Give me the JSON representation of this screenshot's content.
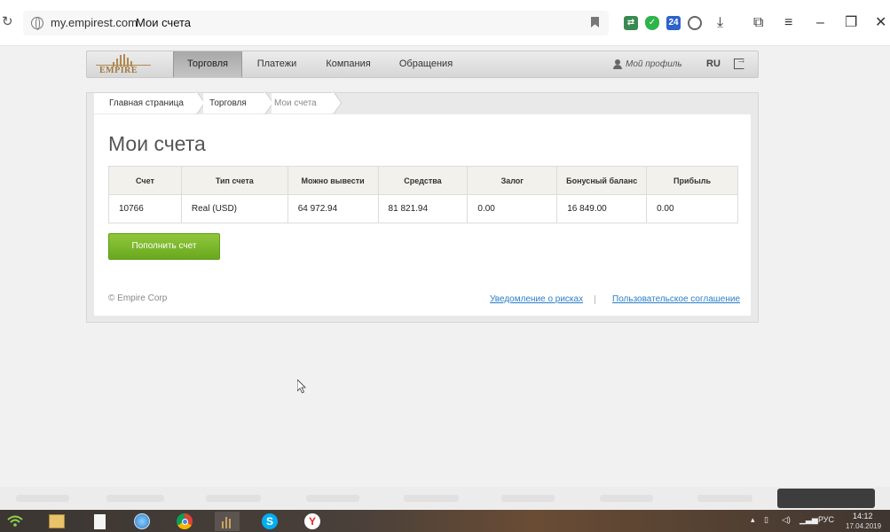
{
  "browser": {
    "domain": "my.empirest.com",
    "page_title": "Мои счета",
    "extension_badge": "24"
  },
  "site": {
    "logo_text": "EMPIRE",
    "nav": [
      "Торговля",
      "Платежи",
      "Компания",
      "Обращения"
    ],
    "active_nav": "Торговля",
    "profile_label": "Мой профиль",
    "language": "RU"
  },
  "breadcrumb": [
    "Главная страница",
    "Торговля",
    "Мои счета"
  ],
  "content": {
    "title": "Мои счета",
    "table": {
      "headers": [
        "Счет",
        "Тип счета",
        "Можно вывести",
        "Средства",
        "Залог",
        "Бонусный баланс",
        "Прибыль"
      ],
      "rows": [
        [
          "10766",
          "Real (USD)",
          "64 972.94",
          "81 821.94",
          "0.00",
          "16 849.00",
          "0.00"
        ]
      ]
    },
    "topup_button": "Пополнить счет"
  },
  "footer": {
    "copyright": "© Empire Corp",
    "risk_link": "Уведомление о рисках",
    "agreement_link": "Пользовательское соглашение"
  },
  "taskbar": {
    "language": "РУС",
    "time": "14:12",
    "date": "17.04.2019"
  },
  "colors": {
    "accent_green": "#7ab82b",
    "link_blue": "#2a7fc4",
    "logo_gold": "#a07a40"
  }
}
